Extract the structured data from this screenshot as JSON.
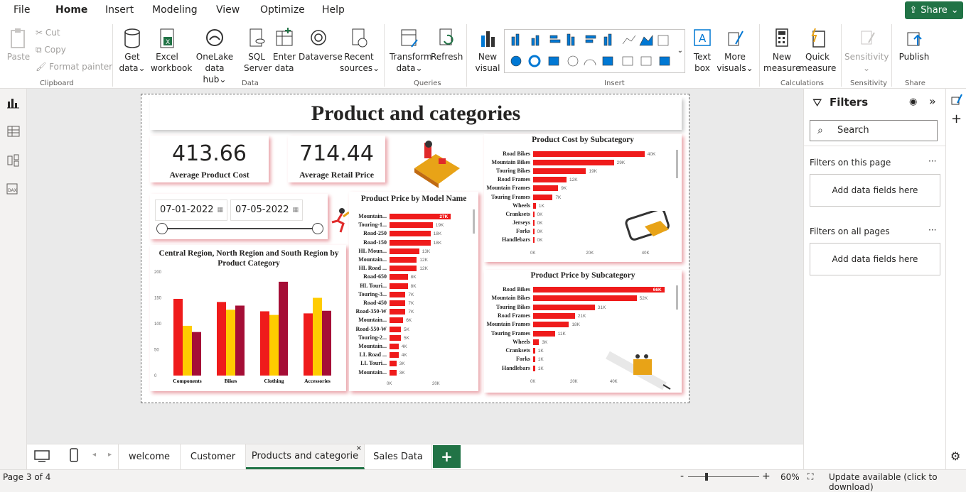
{
  "menu": [
    "File",
    "Home",
    "Insert",
    "Modeling",
    "View",
    "Optimize",
    "Help"
  ],
  "share": "Share",
  "ribbon": {
    "clipboard": {
      "paste": "Paste",
      "cut": "Cut",
      "copy": "Copy",
      "format_painter": "Format painter",
      "group": "Clipboard"
    },
    "data": {
      "get_data": [
        "Get",
        "data"
      ],
      "excel": [
        "Excel",
        "workbook"
      ],
      "onelake": [
        "OneLake data",
        "hub"
      ],
      "sql": [
        "SQL",
        "Server"
      ],
      "enter": [
        "Enter",
        "data"
      ],
      "dataverse": "Dataverse",
      "recent": [
        "Recent",
        "sources"
      ],
      "group": "Data"
    },
    "queries": {
      "transform": [
        "Transform",
        "data"
      ],
      "refresh": "Refresh",
      "group": "Queries"
    },
    "insert": {
      "new_visual": [
        "New",
        "visual"
      ],
      "text_box": [
        "Text",
        "box"
      ],
      "more_visuals": [
        "More",
        "visuals"
      ],
      "group": "Insert"
    },
    "calculations": {
      "new_measure": [
        "New",
        "measure"
      ],
      "quick_measure": [
        "Quick",
        "measure"
      ],
      "group": "Calculations"
    },
    "sensitivity": {
      "label": "Sensitivity",
      "group": "Sensitivity"
    },
    "share": {
      "publish": "Publish",
      "group": "Share"
    }
  },
  "report": {
    "title": "Product and categories",
    "kpi1": {
      "value": "413.66",
      "label": "Average Product Cost"
    },
    "kpi2": {
      "value": "714.44",
      "label": "Average Retail Price"
    },
    "date_from": "07-01-2022",
    "date_to": "07-05-2022"
  },
  "chart_data": [
    {
      "type": "bar",
      "title": "Product Cost by Subcategory",
      "categories": [
        "Road Bikes",
        "Mountain Bikes",
        "Touring Bikes",
        "Road Frames",
        "Mountain Frames",
        "Touring Frames",
        "Wheels",
        "Cranksets",
        "Jerseys",
        "Forks",
        "Handlebars"
      ],
      "values": [
        40,
        29,
        19,
        12,
        9,
        7,
        1,
        0,
        0,
        0,
        0
      ],
      "labels": [
        "40K",
        "29K",
        "19K",
        "12K",
        "9K",
        "7K",
        "1K",
        "0K",
        "0K",
        "0K",
        "0K"
      ],
      "xticks": [
        "0K",
        "20K",
        "40K"
      ],
      "xlim": [
        0,
        50
      ]
    },
    {
      "type": "bar",
      "title": "Product Price by Subcategory",
      "categories": [
        "Road Bikes",
        "Mountain Bikes",
        "Touring Bikes",
        "Road Frames",
        "Mountain Frames",
        "Touring Frames",
        "Wheels",
        "Cranksets",
        "Forks",
        "Handlebars"
      ],
      "values": [
        66,
        52,
        31,
        21,
        18,
        11,
        3,
        1,
        1,
        1
      ],
      "labels": [
        "66K",
        "52K",
        "31K",
        "21K",
        "18K",
        "11K",
        "3K",
        "1K",
        "1K",
        "1K"
      ],
      "xticks": [
        "0K",
        "20K",
        "40K",
        "60K"
      ],
      "xlim": [
        0,
        70
      ]
    },
    {
      "type": "bar",
      "title": "Product Price by Model Name",
      "categories": [
        "Mountain...",
        "Touring-1...",
        "Road-250",
        "Road-150",
        "HL Moun...",
        "Mountain...",
        "HL Road ...",
        "Road-650",
        "HL Touri...",
        "Touring-3...",
        "Road-450",
        "Road-350-W",
        "Mountain...",
        "Road-550-W",
        "Touring-2...",
        "Mountain...",
        "LL Road ...",
        "LL Touri...",
        "Mountain..."
      ],
      "values": [
        27,
        19,
        18,
        18,
        13,
        12,
        12,
        8,
        8,
        7,
        7,
        7,
        6,
        5,
        5,
        4,
        4,
        3,
        3
      ],
      "labels": [
        "27K",
        "19K",
        "18K",
        "18K",
        "13K",
        "12K",
        "12K",
        "8K",
        "8K",
        "7K",
        "7K",
        "7K",
        "6K",
        "5K",
        "5K",
        "4K",
        "4K",
        "3K",
        "3K"
      ],
      "xticks": [
        "0K",
        "20K"
      ],
      "xlim": [
        0,
        35
      ]
    },
    {
      "type": "bar",
      "title": "Central Region, North Region and South Region by Product Category",
      "categories": [
        "Components",
        "Bikes",
        "Clothing",
        "Accessories"
      ],
      "series": [
        {
          "color": "#ef1b1b",
          "values": [
            148,
            142,
            124,
            120
          ]
        },
        {
          "color": "#ffcc00",
          "values": [
            96,
            127,
            117,
            150
          ]
        },
        {
          "color": "#a50e36",
          "values": [
            84,
            135,
            181,
            125
          ]
        }
      ],
      "yticks": [
        "0",
        "50",
        "100",
        "150",
        "200"
      ],
      "ylim": [
        0,
        200
      ]
    }
  ],
  "filters": {
    "title": "Filters",
    "search": "Search",
    "on_page": "Filters on this page",
    "on_all": "Filters on all pages",
    "add": "Add data fields here"
  },
  "tabs": [
    "welcome",
    "Customer",
    "Products and categorie",
    "Sales Data"
  ],
  "status": {
    "page": "Page 3 of 4",
    "zoom": "60%",
    "update": "Update available (click to download)"
  }
}
